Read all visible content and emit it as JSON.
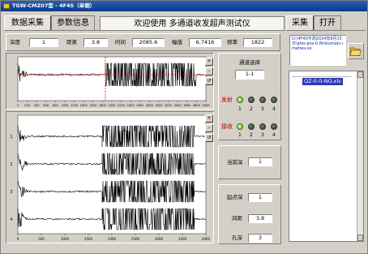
{
  "titlebar": {
    "title": "TGW-CMZ07型 - 4F4S（单侧）"
  },
  "tabs": [
    {
      "label": "数据采集"
    },
    {
      "label": "参数信息"
    },
    {
      "label": "采集"
    },
    {
      "label": "打开"
    }
  ],
  "banner": {
    "text": "欢迎使用 多通道收发超声测试仪"
  },
  "params": {
    "depth_label": "深度",
    "depth_value": "1",
    "distance_label": "距离",
    "distance_value": "3.8",
    "time_label": "时间",
    "time_value": "2085.6",
    "amp_label": "幅值",
    "amp_value": "6.7416",
    "freq_label": "频率",
    "freq_value": "1822"
  },
  "plot_ticks": [
    "0",
    "200",
    "400",
    "600",
    "800",
    "1000",
    "1200",
    "1400",
    "1600",
    "1800",
    "2000",
    "2200",
    "2400",
    "2600",
    "2800",
    "3000",
    "3200",
    "3400",
    "3600",
    "3800",
    "4000"
  ],
  "plot_ticks_short": [
    "0",
    "500",
    "1000",
    "1500",
    "2000",
    "2500",
    "3000",
    "3500",
    "4000"
  ],
  "channel_numbers": [
    "1",
    "2",
    "3",
    "4"
  ],
  "channel_panel": {
    "title": "通道选择",
    "selected": "1-1",
    "transmit_label": "发射",
    "receive_label": "接收",
    "led_numbers": [
      "1",
      "2",
      "3",
      "4"
    ]
  },
  "side_fields": {
    "current_depth_label": "当前深",
    "current_depth_value": "1",
    "start_depth_label": "起点深",
    "start_depth_value": "1",
    "distance_label": "间距",
    "distance_value": "3.8",
    "hole_depth_label": "孔深",
    "hole_depth_value": "3"
  },
  "file_panel": {
    "path": "D:\\4F4S平测2024年8月15日\\afss-pos-0.8mkumojs-imehes-xx",
    "selected_file": "QZ-0-0-NO.xls"
  },
  "icons": {
    "folder": "folder-open-icon",
    "app": "app-icon"
  }
}
